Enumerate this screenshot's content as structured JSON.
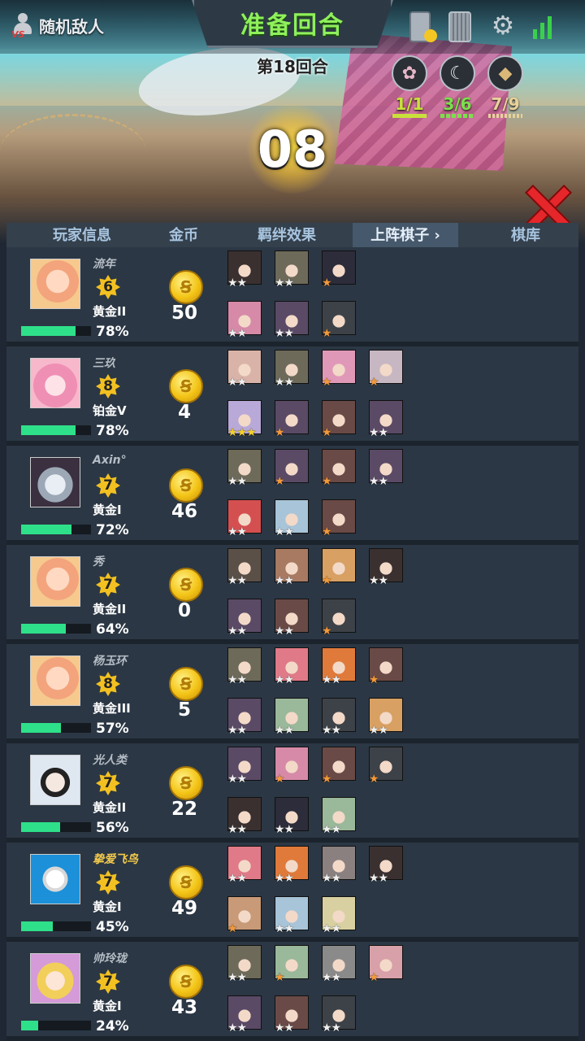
{
  "header": {
    "enemy_label": "随机敌人",
    "phase_title": "准备回合",
    "round_label": "第18回合",
    "timer": "08",
    "traits": [
      {
        "icon": "sakura-trait-icon",
        "value": "1/1",
        "color": "#c9e03a"
      },
      {
        "icon": "moon-trait-icon",
        "value": "3/6",
        "color": "#7be04a"
      },
      {
        "icon": "rock-trait-icon",
        "value": "7/9",
        "color": "#e8d29a"
      }
    ]
  },
  "tabs": {
    "player_info": "玩家信息",
    "gold": "金币",
    "synergy": "羁绊效果",
    "deployed": "上阵棋子",
    "bench": "棋库"
  },
  "players": [
    {
      "name": "流年",
      "level": "6",
      "rank": "黄金II",
      "hp": "78%",
      "hp_value": 0.78,
      "gold": "50",
      "avatar": "peach"
    },
    {
      "name": "三玖",
      "level": "8",
      "rank": "铂金V",
      "hp": "78%",
      "hp_value": 0.78,
      "gold": "4",
      "avatar": "pink"
    },
    {
      "name": "Axin°",
      "level": "7",
      "rank": "黄金I",
      "hp": "72%",
      "hp_value": 0.72,
      "gold": "46",
      "avatar": "hood"
    },
    {
      "name": "秀",
      "level": "7",
      "rank": "黄金II",
      "hp": "64%",
      "hp_value": 0.64,
      "gold": "0",
      "avatar": "peach"
    },
    {
      "name": "杨玉环",
      "level": "8",
      "rank": "黄金III",
      "hp": "57%",
      "hp_value": 0.57,
      "gold": "5",
      "avatar": "peach"
    },
    {
      "name": "光人类",
      "level": "7",
      "rank": "黄金II",
      "hp": "56%",
      "hp_value": 0.56,
      "gold": "22",
      "avatar": "mecha"
    },
    {
      "name": "挚爱飞鸟",
      "level": "7",
      "rank": "黄金I",
      "hp": "45%",
      "hp_value": 0.45,
      "gold": "49",
      "avatar": "blue",
      "highlight": true
    },
    {
      "name": "帅玲珑",
      "level": "7",
      "rank": "黄金I",
      "hp": "24%",
      "hp_value": 0.24,
      "gold": "43",
      "avatar": "blonde"
    }
  ],
  "units": [
    [
      [
        {
          "c": "#3a3030",
          "s": "ww"
        },
        {
          "c": "#6d6a5a",
          "s": "ww"
        },
        {
          "c": "#2c2c3a",
          "s": "b"
        }
      ],
      [
        {
          "c": "#d68aa8",
          "s": "ww"
        },
        {
          "c": "#5a4a66",
          "s": "ww"
        },
        {
          "c": "#3d4248",
          "s": "b"
        }
      ]
    ],
    [
      [
        {
          "c": "#d9b3a8",
          "s": "ww"
        },
        {
          "c": "#6d6a5a",
          "s": "ww"
        },
        {
          "c": "#e098b8",
          "s": "b"
        },
        {
          "c": "#c7b7c2",
          "s": "b"
        }
      ],
      [
        {
          "c": "#b8a9d8",
          "s": "ggg"
        },
        {
          "c": "#5a4a66",
          "s": "b"
        },
        {
          "c": "#6a4a46",
          "s": "b"
        },
        {
          "c": "#5a4a66",
          "s": "ww"
        }
      ]
    ],
    [
      [
        {
          "c": "#6d6a5a",
          "s": "ww"
        },
        {
          "c": "#5a4a66",
          "s": "b"
        },
        {
          "c": "#6a4a46",
          "s": "b"
        },
        {
          "c": "#5a4a66",
          "s": "ww"
        }
      ],
      [
        {
          "c": "#d45050",
          "s": "ww"
        },
        {
          "c": "#a8c4d8",
          "s": "ww"
        },
        {
          "c": "#6a4a46",
          "s": "b"
        }
      ]
    ],
    [
      [
        {
          "c": "#5a5048",
          "s": "ww"
        },
        {
          "c": "#a87a62",
          "s": "ww"
        },
        {
          "c": "#d8a062",
          "s": "b"
        },
        {
          "c": "#3a3030",
          "s": "ww"
        }
      ],
      [
        {
          "c": "#5a4a66",
          "s": "ww"
        },
        {
          "c": "#6a4a46",
          "s": "ww"
        },
        {
          "c": "#3d4248",
          "s": "b"
        }
      ]
    ],
    [
      [
        {
          "c": "#6d6a5a",
          "s": "ww"
        },
        {
          "c": "#e07a88",
          "s": "ww"
        },
        {
          "c": "#e07a3a",
          "s": "ww"
        },
        {
          "c": "#6a4a46",
          "s": "b"
        }
      ],
      [
        {
          "c": "#5a4a66",
          "s": "ww"
        },
        {
          "c": "#9ab89a",
          "s": "ww"
        },
        {
          "c": "#3d4248",
          "s": "ww"
        },
        {
          "c": "#d8a062",
          "s": "ww"
        }
      ]
    ],
    [
      [
        {
          "c": "#5a4a66",
          "s": "ww"
        },
        {
          "c": "#d68aa8",
          "s": "b"
        },
        {
          "c": "#6a4a46",
          "s": "b"
        },
        {
          "c": "#3d4248",
          "s": "b"
        }
      ],
      [
        {
          "c": "#3a3030",
          "s": "ww"
        },
        {
          "c": "#2c2c3a",
          "s": "ww"
        },
        {
          "c": "#9ab89a",
          "s": "ww"
        }
      ]
    ],
    [
      [
        {
          "c": "#e07a88",
          "s": "ww"
        },
        {
          "c": "#e07a3a",
          "s": "ww"
        },
        {
          "c": "#8a8080",
          "s": "ww"
        },
        {
          "c": "#3a3030",
          "s": "ww"
        }
      ],
      [
        {
          "c": "#c89a78",
          "s": "b"
        },
        {
          "c": "#a8c4d8",
          "s": "ww"
        },
        {
          "c": "#d8d0a0",
          "s": "ww"
        }
      ]
    ],
    [
      [
        {
          "c": "#6d6a5a",
          "s": "ww"
        },
        {
          "c": "#9ab89a",
          "s": "b"
        },
        {
          "c": "#8a8a8a",
          "s": "ww"
        },
        {
          "c": "#d8a0a8",
          "s": "b"
        }
      ],
      [
        {
          "c": "#5a4a66",
          "s": "ww"
        },
        {
          "c": "#6a4a46",
          "s": "ww"
        },
        {
          "c": "#3d4248",
          "s": "ww"
        }
      ]
    ]
  ]
}
